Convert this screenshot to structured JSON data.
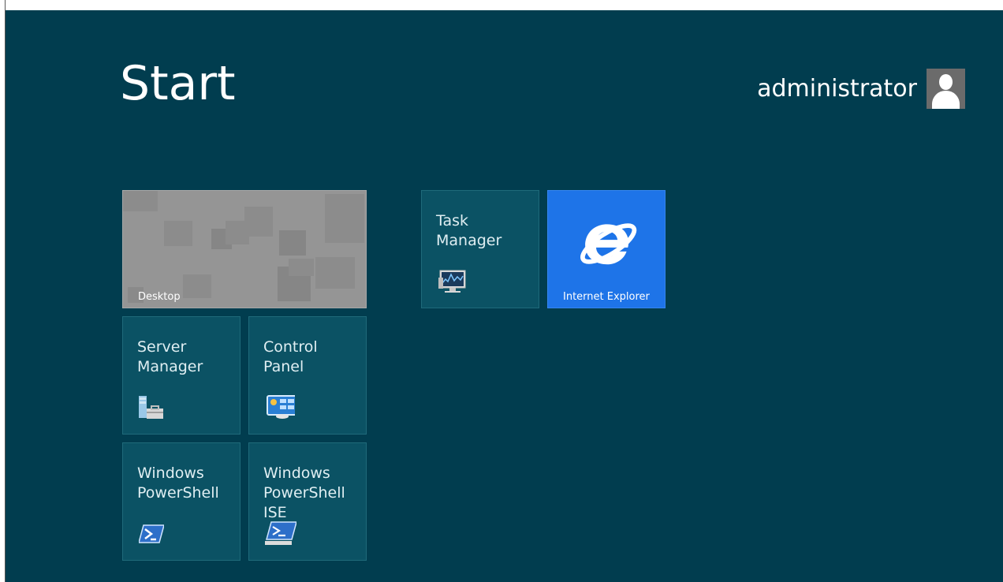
{
  "start": {
    "title": "Start"
  },
  "user": {
    "name": "administrator"
  },
  "tiles": {
    "desktop": {
      "label": "Desktop"
    },
    "server_manager": {
      "label": "Server\nManager",
      "icon": "server-manager-icon"
    },
    "control_panel": {
      "label": "Control\nPanel",
      "icon": "control-panel-icon"
    },
    "powershell": {
      "label": "Windows\nPowerShell",
      "icon": "powershell-icon"
    },
    "powershell_ise": {
      "label": "Windows\nPowerShell\nISE",
      "icon": "powershell-ise-icon"
    },
    "task_manager": {
      "label": "Task\nManager",
      "icon": "task-manager-icon"
    },
    "internet_explorer": {
      "label": "Internet Explorer",
      "icon": "internet-explorer-icon"
    }
  },
  "colors": {
    "background": "#013d4f",
    "tile": "#0b5264",
    "ie_tile": "#1e74e8",
    "desktop_tile": "#959595"
  }
}
